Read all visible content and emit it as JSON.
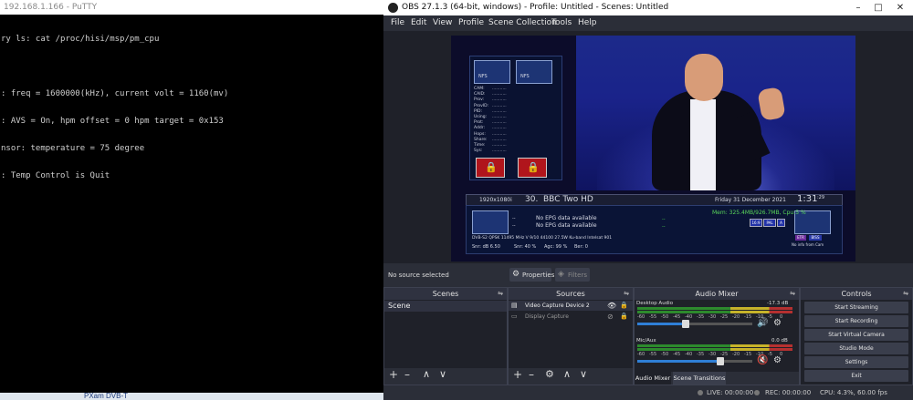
{
  "putty": {
    "title": "192.168.1.166 - PuTTY",
    "lines": [
      "ry ls: cat /proc/hisi/msp/pm_cpu",
      "",
      ": freq = 1600000(kHz), current volt = 1160(mv)",
      ": AVS = On, hpm offset = 0 hpm target = 0x153",
      "nsor: temperature = 75 degree",
      ": Temp Control is Quit"
    ],
    "taskbar_item": "PXam DVB-T"
  },
  "obs": {
    "title": "OBS 27.1.3 (64-bit, windows) - Profile: Untitled - Scenes: Untitled",
    "menu": [
      "File",
      "Edit",
      "View",
      "Profile",
      "Scene Collection",
      "Tools",
      "Help"
    ],
    "preview": {
      "ecm_labels": [
        "CAM:",
        "CAID:",
        "Prov:",
        "ProvID:",
        "PID:",
        "Using:",
        "Prot:",
        "Addr:",
        "Hops:",
        "Share:",
        "Time:",
        "Sys:"
      ],
      "resolution": "1920x1080i",
      "channel_num": "30.",
      "channel_name": "BBC Two HD",
      "date": "Friday  31 December 2021",
      "time": "1:31",
      "time_sec": ":29",
      "mem": "Mem: 325.4MB/926.7MB, Cpu:5 %",
      "badges": [
        "16:9",
        "PAL",
        "A"
      ],
      "badges2": [
        "ETR",
        "BISS"
      ],
      "no_info": "No info from Cam",
      "epg1": "No EPG data available",
      "epg2": "No EPG data available",
      "tech_line": "DVB-S2  QPSK    11495 MHz  V  9/10  44100  27.5W Ku-band Intelsat 901",
      "snr_db": "Snr: dB 6.50",
      "snr_pct": "Snr: 40 %",
      "agc": "Agc: 99 %",
      "ber": "Ber: 0",
      "card_label": "NFS",
      "card_label2": "NFS"
    },
    "status": {
      "no_source": "No source selected",
      "properties": "Properties",
      "filters": "Filters"
    },
    "scenes": {
      "header": "Scenes",
      "items": [
        "Scene"
      ]
    },
    "sources": {
      "header": "Sources",
      "items": [
        "Video Capture Device 2",
        "Display Capture"
      ]
    },
    "mixer": {
      "header": "Audio Mixer",
      "channels": [
        {
          "name": "Desktop Audio",
          "db": "-17.3 dB",
          "level": 0.42,
          "muted": false
        },
        {
          "name": "Mic/Aux",
          "db": "0.0 dB",
          "level": 0.72,
          "muted": true
        }
      ],
      "scale": [
        "-60",
        "-55",
        "-50",
        "-45",
        "-40",
        "-35",
        "-30",
        "-25",
        "-20",
        "-15",
        "-10",
        "-5",
        "0"
      ],
      "tabs": [
        "Audio Mixer",
        "Scene Transitions"
      ]
    },
    "controls": {
      "header": "Controls",
      "buttons": [
        "Start Streaming",
        "Start Recording",
        "Start Virtual Camera",
        "Studio Mode",
        "Settings",
        "Exit"
      ]
    },
    "statusbar": {
      "live": "LIVE: 00:00:00",
      "rec": "REC: 00:00:00",
      "cpu": "CPU: 4.3%, 60.00 fps"
    }
  }
}
